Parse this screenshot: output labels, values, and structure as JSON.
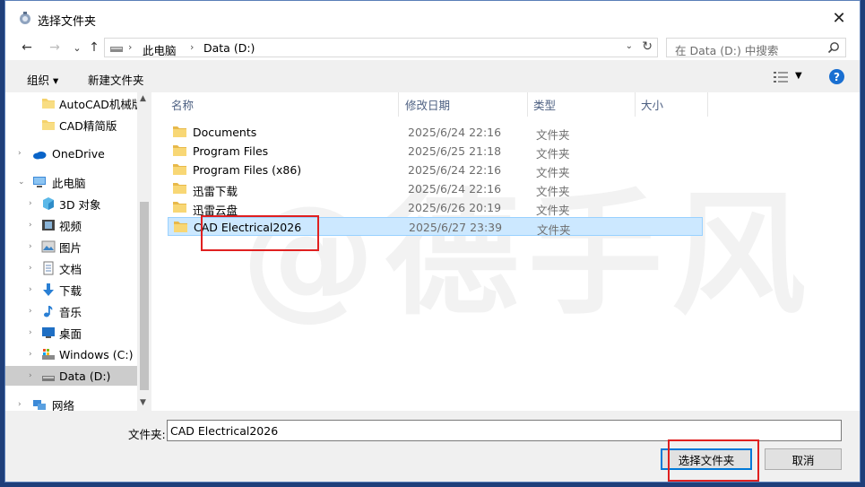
{
  "title": "选择文件夹",
  "close_glyph": "✕",
  "nav": {
    "back": "←",
    "forward": "→",
    "recent": "⌄",
    "up": "↑"
  },
  "address": {
    "crumbs": [
      "此电脑",
      "Data (D:)"
    ],
    "separator": "›"
  },
  "search": {
    "placeholder": "在 Data (D:) 中搜索"
  },
  "toolbar": {
    "organize": "组织 ▾",
    "new_folder": "新建文件夹",
    "help": "?"
  },
  "sidebar": {
    "items": [
      {
        "label": "AutoCAD机械版",
        "icon": "folder-icon"
      },
      {
        "label": "CAD精简版",
        "icon": "folder-icon"
      },
      {
        "label": "OneDrive",
        "icon": "cloud-icon"
      },
      {
        "label": "此电脑",
        "icon": "computer-icon"
      },
      {
        "label": "3D 对象",
        "icon": "cube-icon"
      },
      {
        "label": "视频",
        "icon": "video-icon"
      },
      {
        "label": "图片",
        "icon": "picture-icon"
      },
      {
        "label": "文档",
        "icon": "document-icon"
      },
      {
        "label": "下载",
        "icon": "download-icon"
      },
      {
        "label": "音乐",
        "icon": "music-icon"
      },
      {
        "label": "桌面",
        "icon": "desktop-icon"
      },
      {
        "label": "Windows (C:)",
        "icon": "drive-c-icon"
      },
      {
        "label": "Data (D:)",
        "icon": "drive-d-icon"
      },
      {
        "label": "网络",
        "icon": "network-icon"
      }
    ]
  },
  "columns": {
    "name": "名称",
    "date": "修改日期",
    "type": "类型",
    "size": "大小"
  },
  "files": [
    {
      "name": "Documents",
      "date": "2025/6/24 22:16",
      "type": "文件夹"
    },
    {
      "name": "Program Files",
      "date": "2025/6/25 21:18",
      "type": "文件夹"
    },
    {
      "name": "Program Files (x86)",
      "date": "2025/6/24 22:16",
      "type": "文件夹"
    },
    {
      "name": "迅雷下载",
      "date": "2025/6/24 22:16",
      "type": "文件夹"
    },
    {
      "name": "迅雷云盘",
      "date": "2025/6/26 20:19",
      "type": "文件夹"
    },
    {
      "name": "CAD Electrical2026",
      "date": "2025/6/27 23:39",
      "type": "文件夹"
    }
  ],
  "watermark": "@德手风",
  "footer": {
    "folder_label": "文件夹:",
    "folder_value": "CAD Electrical2026",
    "select_button": "选择文件夹",
    "cancel_button": "取消"
  },
  "colors": {
    "selection": "#cce8ff",
    "highlight_box": "#e02020",
    "accent": "#0078d7"
  }
}
